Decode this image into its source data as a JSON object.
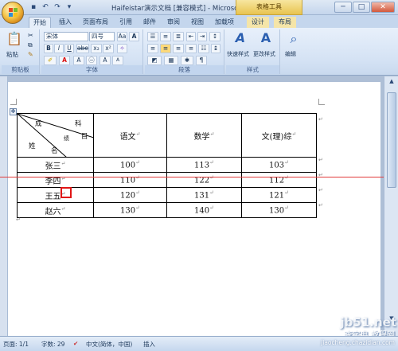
{
  "window": {
    "title": "Haifeistar演示文档 [兼容模式] - Microsoft Word",
    "context_tab": "表格工具",
    "minimize": "─",
    "maximize": "□",
    "close": "✕"
  },
  "ribbon_tabs": [
    "开始",
    "插入",
    "页面布局",
    "引用",
    "邮件",
    "审阅",
    "视图",
    "加载项",
    "设计",
    "布局"
  ],
  "ribbon": {
    "paste_label": "粘贴",
    "clipboard_group": "剪贴板",
    "font_name": "宋体",
    "font_size": "四号",
    "font_group": "字体",
    "paragraph_group": "段落",
    "quick_styles_label": "快速样式",
    "change_styles_label": "更改样式",
    "styles_group": "样式",
    "edit_label": "编辑",
    "bold": "B",
    "italic": "I",
    "underline": "U",
    "strike": "abe",
    "subscript": "x₂",
    "superscript": "x²",
    "font_color": "A",
    "grow_font": "A",
    "aa": "Aa"
  },
  "table": {
    "header": {
      "diag_labels": [
        "成",
        "科",
        "绩",
        "目",
        "姓",
        "名"
      ],
      "columns": [
        "语文",
        "数学",
        "文(理)综"
      ]
    },
    "rows": [
      {
        "name": "张三",
        "values": [
          "100",
          "113",
          "103"
        ]
      },
      {
        "name": "李四",
        "values": [
          "110",
          "122",
          "112"
        ]
      },
      {
        "name": "王五",
        "values": [
          "120",
          "131",
          "121"
        ]
      },
      {
        "name": "赵六",
        "values": [
          "130",
          "140",
          "130"
        ]
      }
    ],
    "cell_mark": "↵"
  },
  "status": {
    "page": "页面: 1/1",
    "words": "字数: 29",
    "language": "中文(简体，中国)",
    "mode": "插入"
  },
  "watermark": {
    "site1": "jb51.net",
    "site2": "查字典 教程网",
    "site3": "jiaocheng.chazidian.com"
  },
  "colors": {
    "accent_line": "#e23b3b",
    "highlight_box": "#e01515"
  }
}
